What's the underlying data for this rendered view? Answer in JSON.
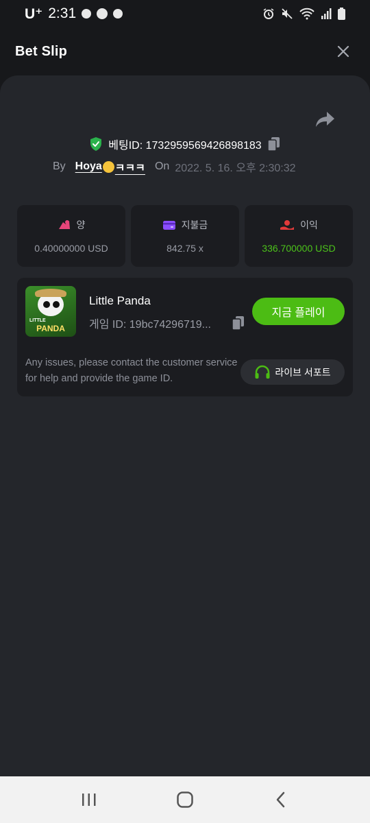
{
  "status_bar": {
    "carrier": "U⁺",
    "time": "2:31",
    "notif_icons": [
      "pill-icon",
      "oi-lock-icon",
      "bubble-icon"
    ],
    "right_icons": [
      "alarm-icon",
      "mute-icon",
      "wifi-icon",
      "signal-icon",
      "battery-icon"
    ]
  },
  "header": {
    "title": "Bet Slip"
  },
  "bet": {
    "id_label": "베팅ID: 1732959569426898183",
    "by_label": "By",
    "user": "Hoya",
    "user_suffix": "ㅋㅋㅋ",
    "on_label": "On",
    "date": "2022. 5. 16. 오후 2:30:32"
  },
  "stats": [
    {
      "label": "양",
      "value": "0.40000000 USD",
      "icon": "bet-amount-icon",
      "color": "#e8457a"
    },
    {
      "label": "지불금",
      "value": "842.75 x",
      "icon": "wallet-icon",
      "color": "#8a4dff"
    },
    {
      "label": "이익",
      "value": "336.700000 USD",
      "icon": "profit-icon",
      "color": "#e23a3a"
    }
  ],
  "game": {
    "title": "Little Panda",
    "id_text": "게임 ID: 19bc74296719...",
    "thumb_text": "PANDA",
    "thumb_small": "LITTLE",
    "play_label": "지금 플레이",
    "help_text": "Any issues, please contact the customer service for help and provide the game ID.",
    "support_label": "라이브 서포트"
  },
  "colors": {
    "accent": "#4cbc14",
    "profit_text": "#4cc31a",
    "verified": "#2bb24c"
  }
}
